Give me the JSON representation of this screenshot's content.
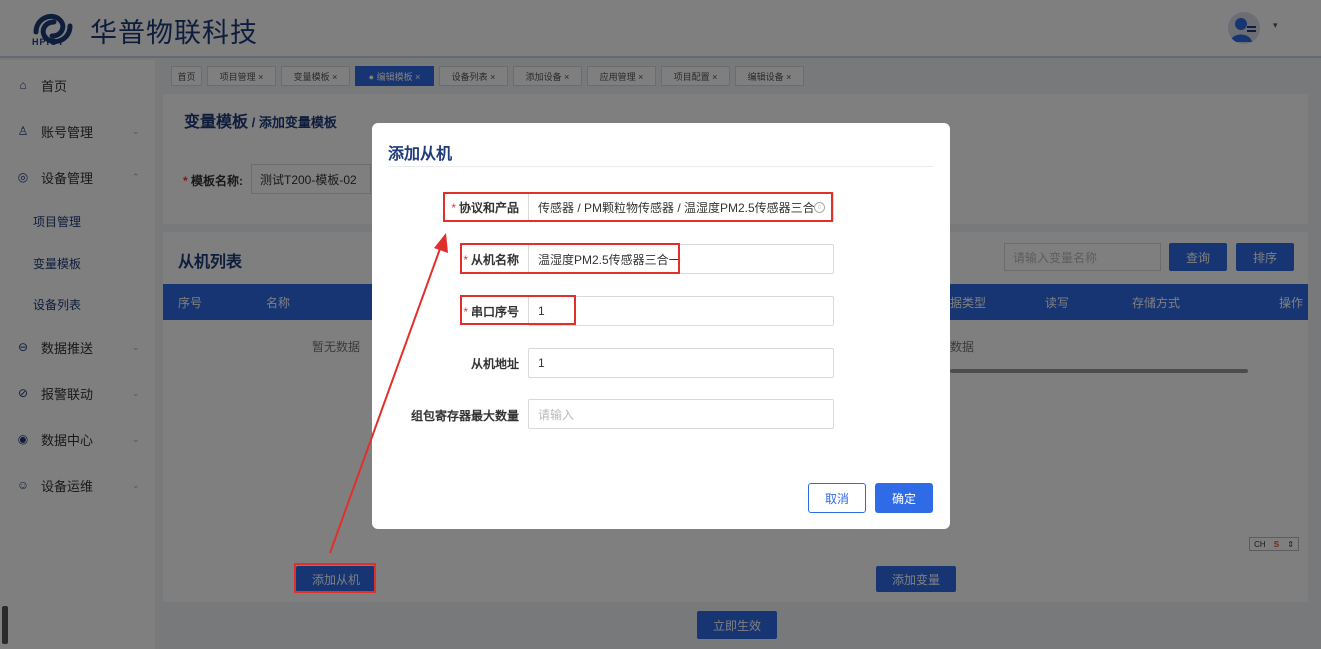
{
  "header": {
    "brand_text": "华普物联科技",
    "logo_sub": "HPIOT",
    "avatar_caret": "▾"
  },
  "sidebar": {
    "items": [
      {
        "label": "首页",
        "icon": "home-icon",
        "glyph": "⌂",
        "arrow": ""
      },
      {
        "label": "账号管理",
        "icon": "user-icon",
        "glyph": "♙",
        "arrow": "⌄"
      },
      {
        "label": "设备管理",
        "icon": "device-icon",
        "glyph": "◎",
        "arrow": "⌃"
      },
      {
        "label": "数据推送",
        "icon": "push-icon",
        "glyph": "⊖",
        "arrow": "⌄"
      },
      {
        "label": "报警联动",
        "icon": "alarm-icon",
        "glyph": "⊘",
        "arrow": "⌄"
      },
      {
        "label": "数据中心",
        "icon": "data-center-icon",
        "glyph": "◉",
        "arrow": "⌄"
      },
      {
        "label": "设备运维",
        "icon": "maintenance-icon",
        "glyph": "☺",
        "arrow": "⌄"
      }
    ],
    "sub_items": [
      "项目管理",
      "变量模板",
      "设备列表"
    ]
  },
  "tabs": [
    {
      "label": "首页"
    },
    {
      "label": "项目管理 ×"
    },
    {
      "label": "变量模板 ×"
    },
    {
      "label": "● 编辑模板 ×"
    },
    {
      "label": "设备列表 ×"
    },
    {
      "label": "添加设备 ×"
    },
    {
      "label": "应用管理 ×"
    },
    {
      "label": "项目配置 ×"
    },
    {
      "label": "编辑设备 ×"
    }
  ],
  "page": {
    "title": "变量模板",
    "breadcrumb": " / 添加变量模板",
    "template_name_label": "模板名称:",
    "template_name_value": "测试T200-模板-02",
    "slave_list_title": "从机列表",
    "slave_columns": [
      "序号",
      "名称"
    ],
    "var_columns": [
      "据类型",
      "读写",
      "存储方式",
      "操作"
    ],
    "no_data_left": "暂无数据",
    "no_data_right": "数据",
    "search_placeholder": "请输入变量名称",
    "query_button": "查询",
    "sort_button": "排序",
    "add_slave_button": "添加从机",
    "add_var_button": "添加变量",
    "apply_button": "立即生效"
  },
  "dialog": {
    "title": "添加从机",
    "fields": [
      {
        "label": "协议和产品",
        "required": "*",
        "value": "传感器 / PM颗粒物传感器 / 温湿度PM2.5传感器三合",
        "placeholder": ""
      },
      {
        "label": "从机名称",
        "required": "*",
        "value": "温湿度PM2.5传感器三合一",
        "placeholder": ""
      },
      {
        "label": "串口序号",
        "required": "*",
        "value": "1",
        "placeholder": ""
      },
      {
        "label": "从机地址",
        "required": "",
        "value": "1",
        "placeholder": ""
      },
      {
        "label": "组包寄存器最大数量",
        "required": "",
        "value": "",
        "placeholder": "请输入"
      }
    ],
    "cancel_button": "取消",
    "confirm_button": "确定",
    "clear_glyph": "○"
  },
  "ime": {
    "label": "CH",
    "glyph": "S",
    "caret": "⇕"
  },
  "colors": {
    "primary": "#2f6be6",
    "brand": "#1f3b7a",
    "annotation": "#e0302c",
    "required": "#e23b3b"
  }
}
